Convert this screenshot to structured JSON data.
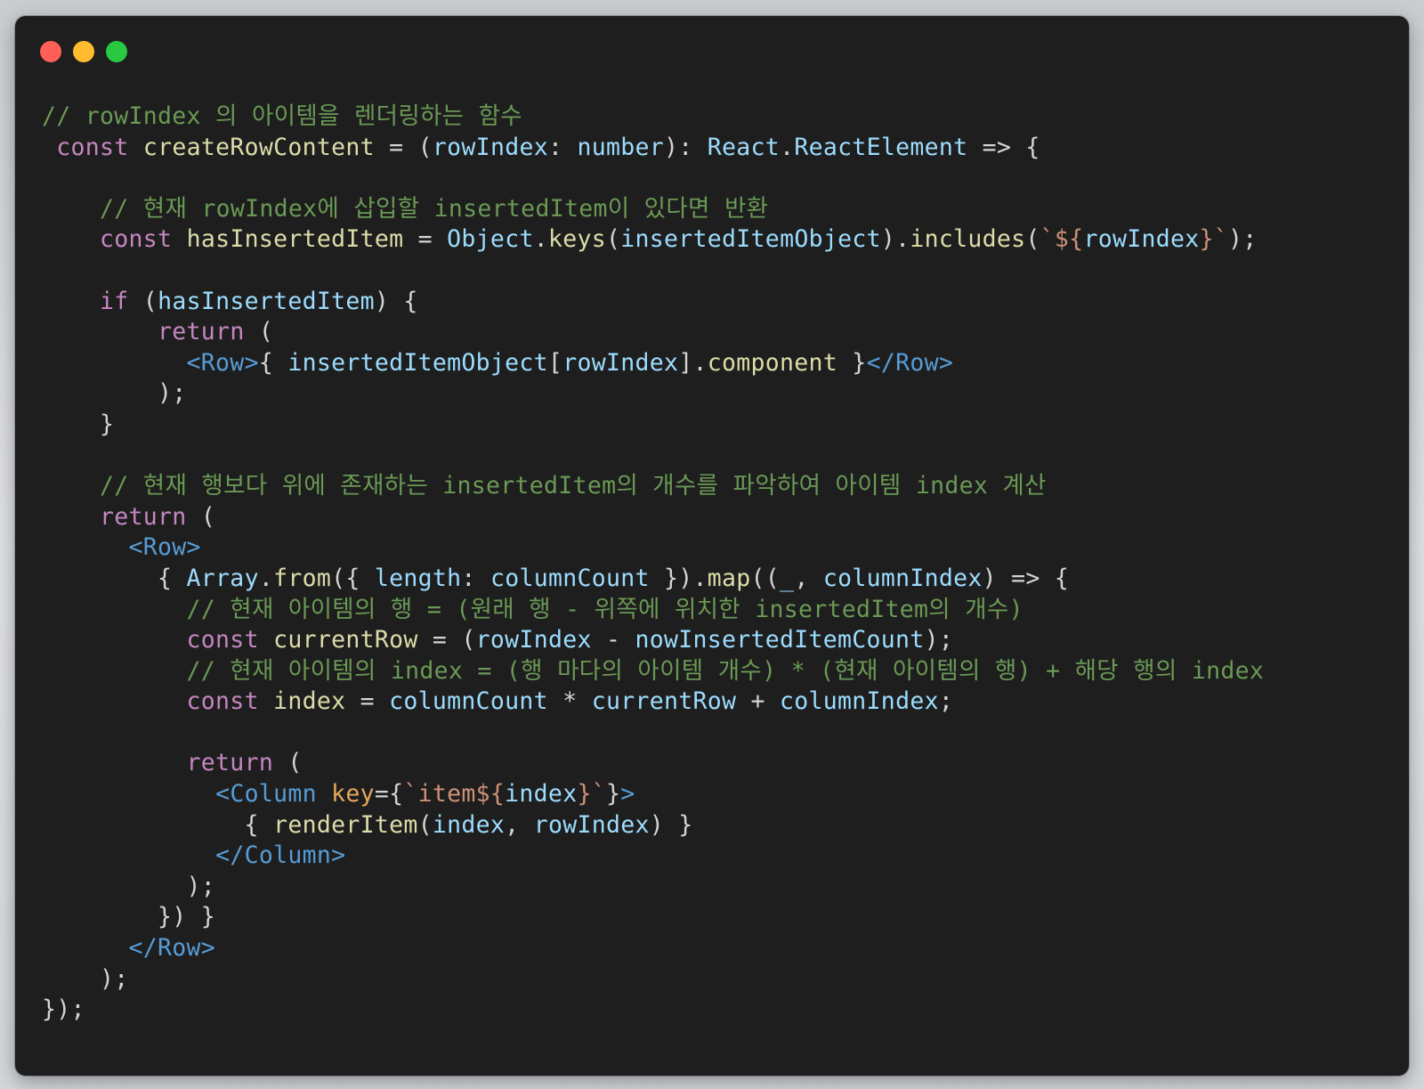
{
  "window": {
    "controls": [
      {
        "name": "close",
        "color": "#ff5f57"
      },
      {
        "name": "minimize",
        "color": "#febc2e"
      },
      {
        "name": "zoom",
        "color": "#28c840"
      }
    ],
    "background": "#1e1e1e"
  },
  "colors": {
    "comment": "#6a9955",
    "keyword": "#c586c0",
    "variable": "#9cdcfe",
    "function": "#dcdcaa",
    "tag": "#569cd6",
    "attribute": "#e6a85c",
    "string": "#ce9178",
    "plain": "#d4d4d4"
  },
  "code": {
    "language": "tsx",
    "lines": [
      [
        {
          "t": "// rowIndex 의 아이템을 렌더링하는 함수",
          "c": "comment"
        }
      ],
      [
        {
          "t": " ",
          "c": "plain"
        },
        {
          "t": "const",
          "c": "storage"
        },
        {
          "t": " ",
          "c": "plain"
        },
        {
          "t": "createRowContent",
          "c": "func"
        },
        {
          "t": " = (",
          "c": "plain"
        },
        {
          "t": "rowIndex",
          "c": "var"
        },
        {
          "t": ": ",
          "c": "plain"
        },
        {
          "t": "number",
          "c": "var"
        },
        {
          "t": "): ",
          "c": "plain"
        },
        {
          "t": "React",
          "c": "var"
        },
        {
          "t": ".",
          "c": "plain"
        },
        {
          "t": "ReactElement",
          "c": "var"
        },
        {
          "t": " => {",
          "c": "plain"
        }
      ],
      [],
      [
        {
          "t": "    // 현재 rowIndex에 삽입할 insertedItem이 있다면 반환",
          "c": "comment"
        }
      ],
      [
        {
          "t": "    ",
          "c": "plain"
        },
        {
          "t": "const",
          "c": "storage"
        },
        {
          "t": " ",
          "c": "plain"
        },
        {
          "t": "hasInsertedItem",
          "c": "func"
        },
        {
          "t": " = ",
          "c": "plain"
        },
        {
          "t": "Object",
          "c": "var"
        },
        {
          "t": ".",
          "c": "plain"
        },
        {
          "t": "keys",
          "c": "func"
        },
        {
          "t": "(",
          "c": "plain"
        },
        {
          "t": "insertedItemObject",
          "c": "var"
        },
        {
          "t": ").",
          "c": "plain"
        },
        {
          "t": "includes",
          "c": "func"
        },
        {
          "t": "(",
          "c": "plain"
        },
        {
          "t": "`${",
          "c": "string"
        },
        {
          "t": "rowIndex",
          "c": "var"
        },
        {
          "t": "}`",
          "c": "string"
        },
        {
          "t": ");",
          "c": "plain"
        }
      ],
      [],
      [
        {
          "t": "    ",
          "c": "plain"
        },
        {
          "t": "if",
          "c": "keyword"
        },
        {
          "t": " (",
          "c": "plain"
        },
        {
          "t": "hasInsertedItem",
          "c": "var"
        },
        {
          "t": ") {",
          "c": "plain"
        }
      ],
      [
        {
          "t": "        ",
          "c": "plain"
        },
        {
          "t": "return",
          "c": "keyword"
        },
        {
          "t": " (",
          "c": "plain"
        }
      ],
      [
        {
          "t": "          ",
          "c": "plain"
        },
        {
          "t": "<Row>",
          "c": "tag"
        },
        {
          "t": "{ ",
          "c": "plain"
        },
        {
          "t": "insertedItemObject",
          "c": "var"
        },
        {
          "t": "[",
          "c": "plain"
        },
        {
          "t": "rowIndex",
          "c": "var"
        },
        {
          "t": "].",
          "c": "plain"
        },
        {
          "t": "component",
          "c": "func"
        },
        {
          "t": " }",
          "c": "plain"
        },
        {
          "t": "</Row>",
          "c": "tag"
        }
      ],
      [
        {
          "t": "        );",
          "c": "plain"
        }
      ],
      [
        {
          "t": "    }",
          "c": "plain"
        }
      ],
      [],
      [
        {
          "t": "    // 현재 행보다 위에 존재하는 insertedItem의 개수를 파악하여 아이템 index 계산",
          "c": "comment"
        }
      ],
      [
        {
          "t": "    ",
          "c": "plain"
        },
        {
          "t": "return",
          "c": "keyword"
        },
        {
          "t": " (",
          "c": "plain"
        }
      ],
      [
        {
          "t": "      ",
          "c": "plain"
        },
        {
          "t": "<Row>",
          "c": "tag"
        }
      ],
      [
        {
          "t": "        { ",
          "c": "plain"
        },
        {
          "t": "Array",
          "c": "var"
        },
        {
          "t": ".",
          "c": "plain"
        },
        {
          "t": "from",
          "c": "func"
        },
        {
          "t": "({ ",
          "c": "plain"
        },
        {
          "t": "length",
          "c": "var"
        },
        {
          "t": ": ",
          "c": "plain"
        },
        {
          "t": "columnCount",
          "c": "var"
        },
        {
          "t": " }).",
          "c": "plain"
        },
        {
          "t": "map",
          "c": "func"
        },
        {
          "t": "((",
          "c": "plain"
        },
        {
          "t": "_",
          "c": "var"
        },
        {
          "t": ", ",
          "c": "plain"
        },
        {
          "t": "columnIndex",
          "c": "var"
        },
        {
          "t": ") => {",
          "c": "plain"
        }
      ],
      [
        {
          "t": "          // 현재 아이템의 행 = (원래 행 - 위쪽에 위치한 insertedItem의 개수)",
          "c": "comment"
        }
      ],
      [
        {
          "t": "          ",
          "c": "plain"
        },
        {
          "t": "const",
          "c": "storage"
        },
        {
          "t": " ",
          "c": "plain"
        },
        {
          "t": "currentRow",
          "c": "func"
        },
        {
          "t": " = (",
          "c": "plain"
        },
        {
          "t": "rowIndex",
          "c": "var"
        },
        {
          "t": " - ",
          "c": "plain"
        },
        {
          "t": "nowInsertedItemCount",
          "c": "var"
        },
        {
          "t": ");",
          "c": "plain"
        }
      ],
      [
        {
          "t": "          // 현재 아이템의 index = (행 마다의 아이템 개수) * (현재 아이템의 행) + 해당 행의 index",
          "c": "comment"
        }
      ],
      [
        {
          "t": "          ",
          "c": "plain"
        },
        {
          "t": "const",
          "c": "storage"
        },
        {
          "t": " ",
          "c": "plain"
        },
        {
          "t": "index",
          "c": "func"
        },
        {
          "t": " = ",
          "c": "plain"
        },
        {
          "t": "columnCount",
          "c": "var"
        },
        {
          "t": " * ",
          "c": "plain"
        },
        {
          "t": "currentRow",
          "c": "var"
        },
        {
          "t": " + ",
          "c": "plain"
        },
        {
          "t": "columnIndex",
          "c": "var"
        },
        {
          "t": ";",
          "c": "plain"
        }
      ],
      [],
      [
        {
          "t": "          ",
          "c": "plain"
        },
        {
          "t": "return",
          "c": "keyword"
        },
        {
          "t": " (",
          "c": "plain"
        }
      ],
      [
        {
          "t": "            ",
          "c": "plain"
        },
        {
          "t": "<Column",
          "c": "tag"
        },
        {
          "t": " ",
          "c": "plain"
        },
        {
          "t": "key",
          "c": "attr"
        },
        {
          "t": "={",
          "c": "plain"
        },
        {
          "t": "`item${",
          "c": "string"
        },
        {
          "t": "index",
          "c": "var"
        },
        {
          "t": "}`",
          "c": "string"
        },
        {
          "t": "}",
          "c": "plain"
        },
        {
          "t": ">",
          "c": "tag"
        }
      ],
      [
        {
          "t": "              { ",
          "c": "plain"
        },
        {
          "t": "renderItem",
          "c": "func"
        },
        {
          "t": "(",
          "c": "plain"
        },
        {
          "t": "index",
          "c": "var"
        },
        {
          "t": ", ",
          "c": "plain"
        },
        {
          "t": "rowIndex",
          "c": "var"
        },
        {
          "t": ") }",
          "c": "plain"
        }
      ],
      [
        {
          "t": "            ",
          "c": "plain"
        },
        {
          "t": "</Column>",
          "c": "tag"
        }
      ],
      [
        {
          "t": "          );",
          "c": "plain"
        }
      ],
      [
        {
          "t": "        }) }",
          "c": "plain"
        }
      ],
      [
        {
          "t": "      ",
          "c": "plain"
        },
        {
          "t": "</Row>",
          "c": "tag"
        }
      ],
      [
        {
          "t": "    );",
          "c": "plain"
        }
      ],
      [
        {
          "t": "});",
          "c": "plain"
        }
      ]
    ]
  }
}
